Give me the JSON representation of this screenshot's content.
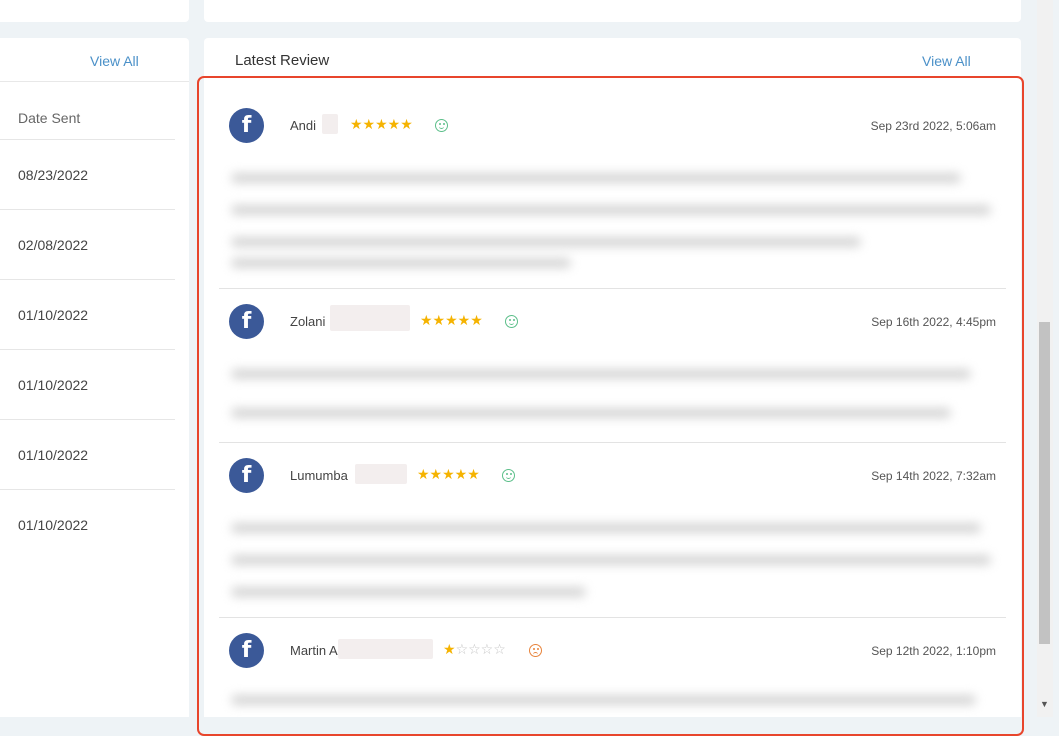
{
  "left_panel": {
    "view_all": "View All",
    "column_header": "Date Sent",
    "dates": [
      "08/23/2022",
      "02/08/2022",
      "01/10/2022",
      "01/10/2022",
      "01/10/2022",
      "01/10/2022"
    ]
  },
  "main_panel": {
    "title": "Latest Review",
    "view_all": "View All"
  },
  "reviews": [
    {
      "reviewer": "Andi",
      "rating": 5,
      "sentiment": "positive",
      "date": "Sep 23rd 2022, 5:06am",
      "source": "facebook-icon"
    },
    {
      "reviewer": "Zolani",
      "rating": 5,
      "sentiment": "positive",
      "date": "Sep 16th 2022, 4:45pm",
      "source": "facebook-icon"
    },
    {
      "reviewer": "Lumumba",
      "rating": 5,
      "sentiment": "positive",
      "date": "Sep 14th 2022, 7:32am",
      "source": "facebook-icon"
    },
    {
      "reviewer": "Martin A",
      "rating": 1,
      "sentiment": "negative",
      "date": "Sep 12th 2022, 1:10pm",
      "source": "facebook-icon"
    }
  ],
  "colors": {
    "link": "#4a90c8",
    "facebook": "#3b5998",
    "star": "#f5b301",
    "highlight": "#e8452c",
    "positive": "#5cbf8a",
    "negative": "#e8843c"
  }
}
